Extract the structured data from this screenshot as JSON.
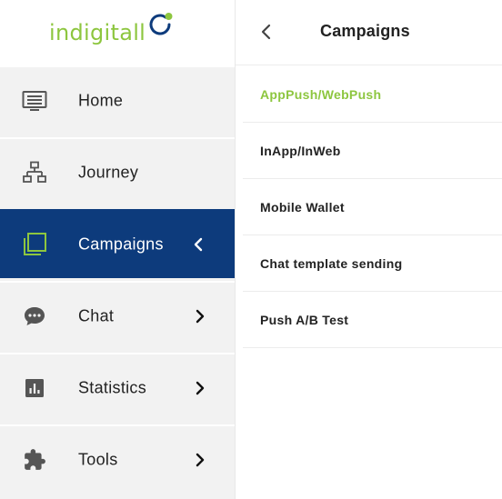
{
  "brand": {
    "logo_text": "indigitall",
    "accent_color": "#8dc63f",
    "active_bg": "#0d3b7c"
  },
  "sidebar": {
    "items": [
      {
        "label": "Home",
        "icon": "monitor-list-icon"
      },
      {
        "label": "Journey",
        "icon": "sitemap-icon"
      },
      {
        "label": "Campaigns",
        "icon": "layers-icon",
        "active": true,
        "chevron": "left"
      },
      {
        "label": "Chat",
        "icon": "chat-bubble-icon",
        "chevron": "right"
      },
      {
        "label": "Statistics",
        "icon": "bar-chart-icon",
        "chevron": "right"
      },
      {
        "label": "Tools",
        "icon": "puzzle-icon",
        "chevron": "right"
      }
    ]
  },
  "panel": {
    "title": "Campaigns",
    "back_icon": "chevron-left-icon",
    "items": [
      {
        "label": "AppPush/WebPush",
        "selected": true
      },
      {
        "label": "InApp/InWeb"
      },
      {
        "label": "Mobile Wallet"
      },
      {
        "label": "Chat template sending"
      },
      {
        "label": "Push A/B Test"
      }
    ]
  }
}
